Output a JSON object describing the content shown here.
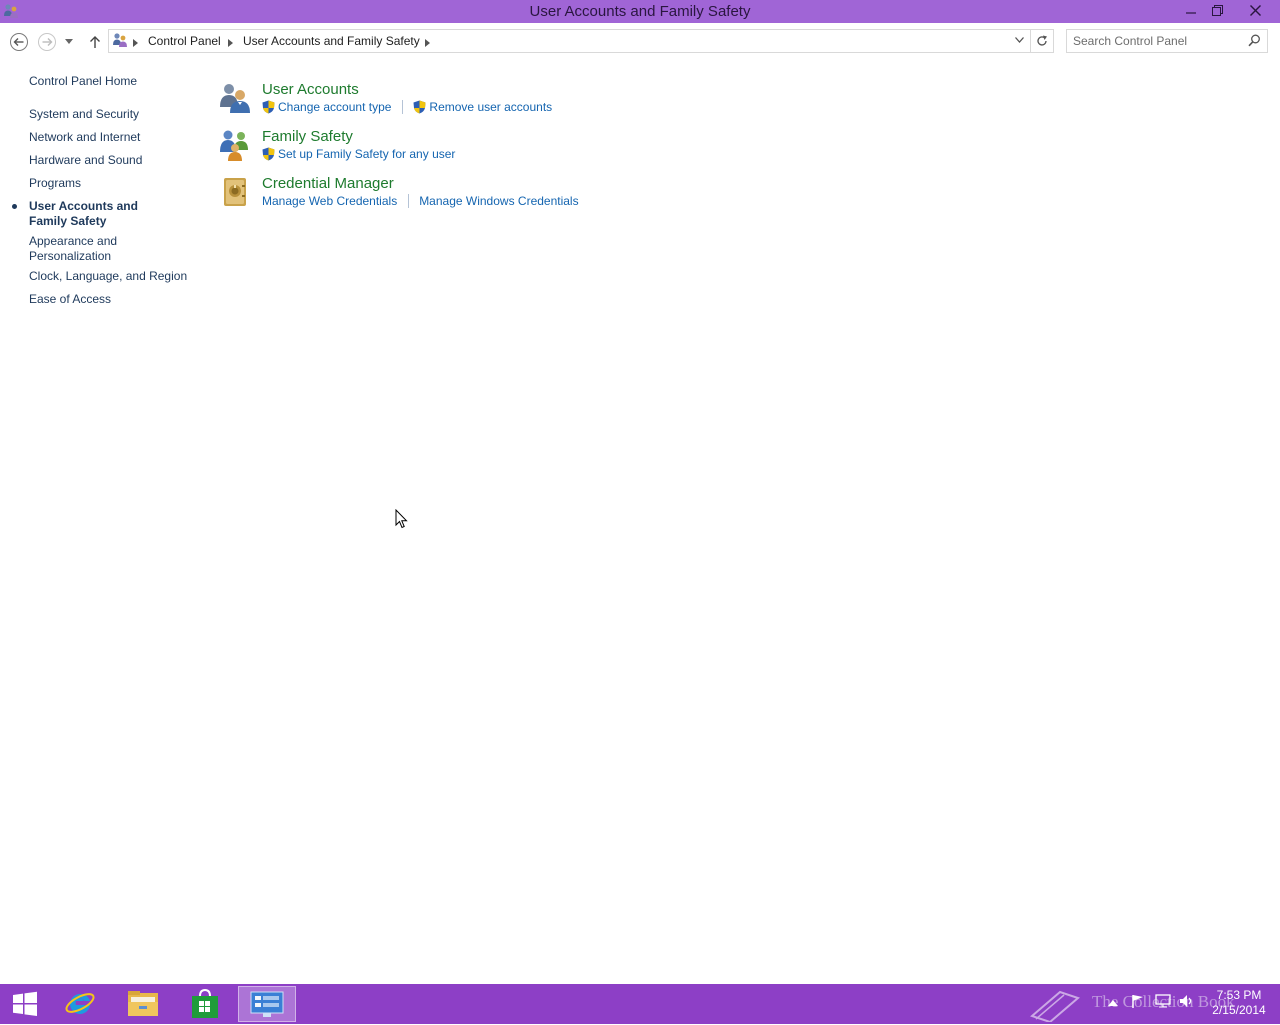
{
  "window": {
    "title": "User Accounts and Family Safety",
    "accent_color": "#a065d6"
  },
  "navigation": {
    "breadcrumbs": [
      "Control Panel",
      "User Accounts and Family Safety"
    ],
    "search_placeholder": "Search Control Panel"
  },
  "left_pane": {
    "home": "Control Panel Home",
    "items": [
      {
        "label": "System and Security",
        "active": false
      },
      {
        "label": "Network and Internet",
        "active": false
      },
      {
        "label": "Hardware and Sound",
        "active": false
      },
      {
        "label": "Programs",
        "active": false
      },
      {
        "label": "User Accounts and Family Safety",
        "active": true
      },
      {
        "label": "Appearance and Personalization",
        "active": false
      },
      {
        "label": "Clock, Language, and Region",
        "active": false
      },
      {
        "label": "Ease of Access",
        "active": false
      }
    ]
  },
  "categories": [
    {
      "title": "User Accounts",
      "icon": "user-accounts-icon",
      "links": [
        {
          "label": "Change account type",
          "shield": true
        },
        {
          "label": "Remove user accounts",
          "shield": true
        }
      ]
    },
    {
      "title": "Family Safety",
      "icon": "family-safety-icon",
      "links": [
        {
          "label": "Set up Family Safety for any user",
          "shield": true
        }
      ]
    },
    {
      "title": "Credential Manager",
      "icon": "credential-manager-icon",
      "links": [
        {
          "label": "Manage Web Credentials",
          "shield": false
        },
        {
          "label": "Manage Windows Credentials",
          "shield": false
        }
      ]
    }
  ],
  "taskbar": {
    "color": "#8d3fc6",
    "apps": [
      "start-icon",
      "internet-explorer-icon",
      "file-explorer-icon",
      "store-icon",
      "control-panel-icon"
    ],
    "watermark": "The Collection Book",
    "time": "7:53 PM",
    "date": "2/15/2014"
  }
}
